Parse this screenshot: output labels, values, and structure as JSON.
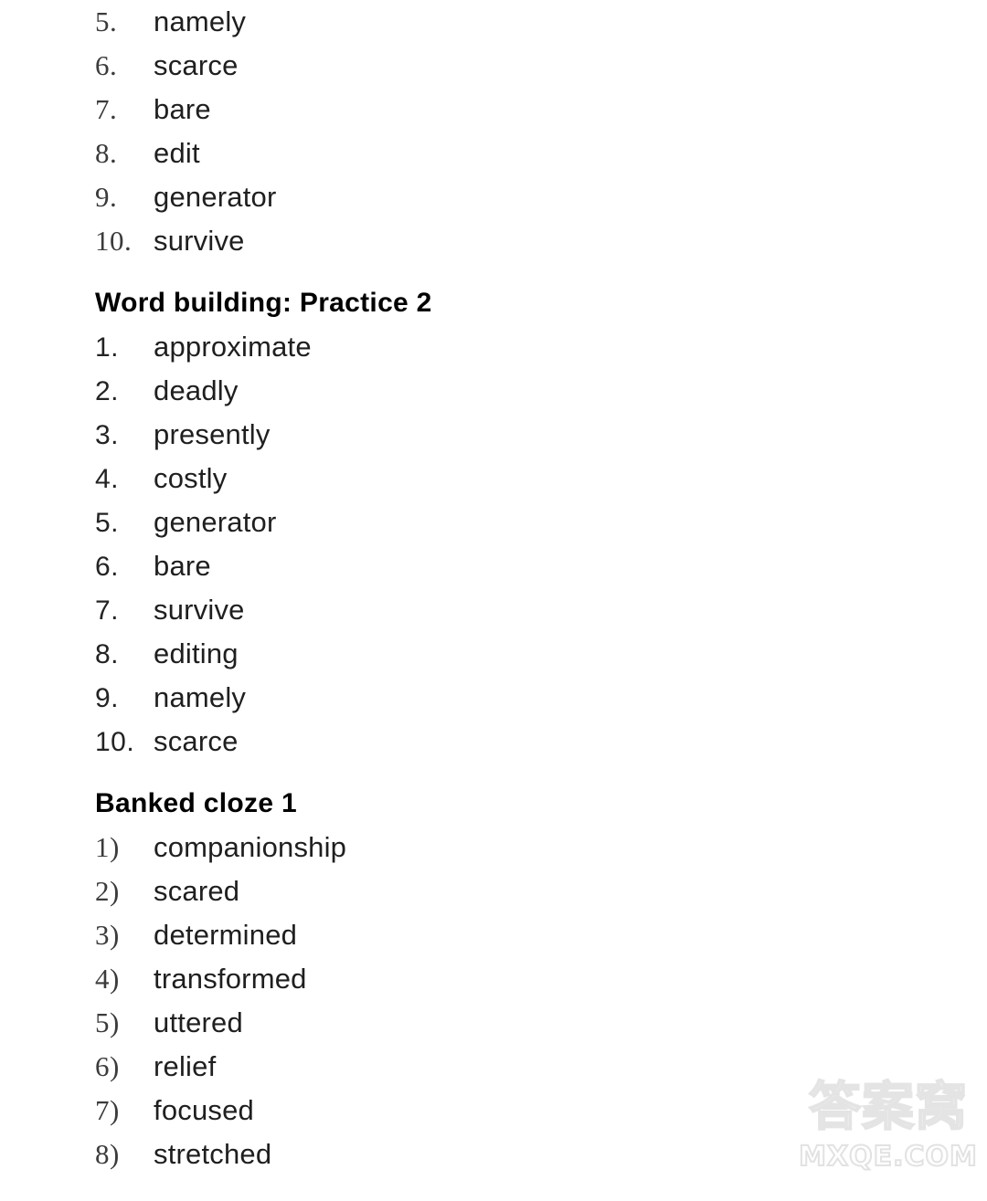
{
  "document": {
    "background_color": "#ffffff",
    "text_color": "#1f1f1f"
  },
  "sections": [
    {
      "id": "word-building-practice-1-continued",
      "heading": null,
      "number_style": "serif-dot",
      "items": [
        {
          "number": "5.",
          "word": "namely"
        },
        {
          "number": "6.",
          "word": "scarce"
        },
        {
          "number": "7.",
          "word": "bare"
        },
        {
          "number": "8.",
          "word": "edit"
        },
        {
          "number": "9.",
          "word": "generator"
        },
        {
          "number": "10.",
          "word": "survive"
        }
      ]
    },
    {
      "id": "word-building-practice-2",
      "heading": "Word building: Practice 2",
      "number_style": "sans-dot",
      "items": [
        {
          "number": "1.",
          "word": "approximate"
        },
        {
          "number": "2.",
          "word": "deadly"
        },
        {
          "number": "3.",
          "word": "presently"
        },
        {
          "number": "4.",
          "word": "costly"
        },
        {
          "number": "5.",
          "word": "generator"
        },
        {
          "number": "6.",
          "word": "bare"
        },
        {
          "number": "7.",
          "word": "survive"
        },
        {
          "number": "8.",
          "word": "editing"
        },
        {
          "number": "9.",
          "word": "namely"
        },
        {
          "number": "10.",
          "word": "scarce"
        }
      ]
    },
    {
      "id": "banked-cloze-1",
      "heading": "Banked cloze 1",
      "number_style": "serif-paren",
      "items": [
        {
          "number": "1)",
          "word": "companionship"
        },
        {
          "number": "2)",
          "word": "scared"
        },
        {
          "number": "3)",
          "word": "determined"
        },
        {
          "number": "4)",
          "word": "transformed"
        },
        {
          "number": "5)",
          "word": "uttered"
        },
        {
          "number": "6)",
          "word": "relief"
        },
        {
          "number": "7)",
          "word": "focused"
        },
        {
          "number": "8)",
          "word": "stretched"
        }
      ]
    }
  ],
  "watermark": {
    "chinese_text": "答案窝",
    "domain_text": "MXQE.COM",
    "color": "#e4e4e4"
  }
}
